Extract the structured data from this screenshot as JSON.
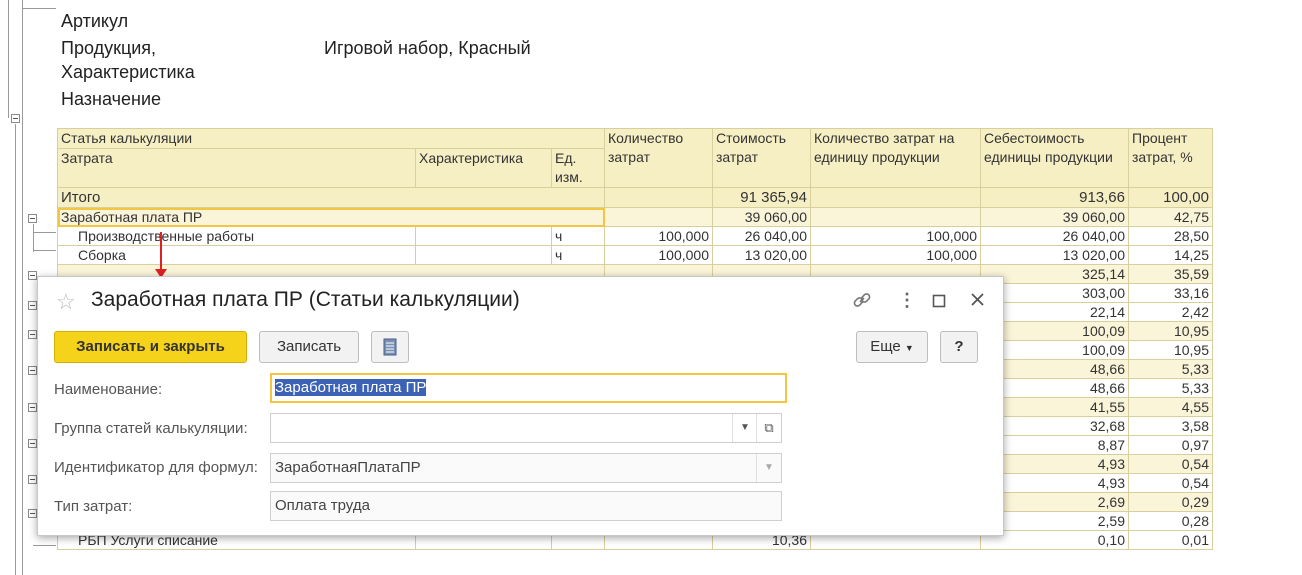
{
  "header": {
    "article_label": "Артикул",
    "product_label_1": "Продукция,",
    "product_label_2": "Характеристика",
    "product_value": "Игровой набор, Красный",
    "purpose_label": "Назначение"
  },
  "report": {
    "columns": {
      "item": "Статья калькуляции",
      "cost_item": "Затрата",
      "characteristic": "Характеристика",
      "unit_1": "Ед.",
      "unit_2": "изм.",
      "qty_1": "Количество",
      "qty_2": "затрат",
      "cost_1": "Стоимость",
      "cost_2": "затрат",
      "per_unit_1": "Количество затрат на",
      "per_unit_2": "единицу продукции",
      "unit_cost_1": "Себестоимость",
      "unit_cost_2": "единицы продукции",
      "percent_1": "Процент",
      "percent_2": "затрат, %"
    },
    "total": {
      "label": "Итого",
      "cost": "91 365,94",
      "unit_cost": "913,66",
      "percent": "100,00"
    },
    "rows": [
      {
        "name": "Заработная плата ПР",
        "char": "",
        "unit": "",
        "qty": "",
        "cost": "39 060,00",
        "per_unit": "",
        "unit_cost": "39 060,00",
        "percent": "42,75"
      },
      {
        "name": "Производственные работы",
        "char": "",
        "unit": "ч",
        "qty": "100,000",
        "cost": "26 040,00",
        "per_unit": "100,000",
        "unit_cost": "26 040,00",
        "percent": "28,50"
      },
      {
        "name": "Сборка",
        "char": "",
        "unit": "ч",
        "qty": "100,000",
        "cost": "13 020,00",
        "per_unit": "100,000",
        "unit_cost": "13 020,00",
        "percent": "14,25"
      }
    ],
    "right_values": [
      {
        "unit_cost": "325,14",
        "percent": "35,59"
      },
      {
        "unit_cost": "303,00",
        "percent": "33,16"
      },
      {
        "unit_cost": "22,14",
        "percent": "2,42"
      },
      {
        "unit_cost": "100,09",
        "percent": "10,95"
      },
      {
        "unit_cost": "100,09",
        "percent": "10,95"
      },
      {
        "unit_cost": "48,66",
        "percent": "5,33"
      },
      {
        "unit_cost": "48,66",
        "percent": "5,33"
      },
      {
        "unit_cost": "41,55",
        "percent": "4,55"
      },
      {
        "unit_cost": "32,68",
        "percent": "3,58"
      },
      {
        "unit_cost": "8,87",
        "percent": "0,97"
      },
      {
        "unit_cost": "4,93",
        "percent": "0,54"
      },
      {
        "unit_cost": "4,93",
        "percent": "0,54"
      },
      {
        "unit_cost": "2,69",
        "percent": "0,29"
      },
      {
        "unit_cost": "2,59",
        "percent": "0,28"
      }
    ],
    "last_row": {
      "name": "РБП Услуги списание",
      "cost": "10,36",
      "unit_cost": "0,10",
      "percent": "0,01"
    }
  },
  "dialog": {
    "title": "Заработная плата ПР (Статьи калькуляции)",
    "toolbar": {
      "save_close": "Записать и закрыть",
      "save": "Записать",
      "more": "Еще",
      "help": "?"
    },
    "fields": {
      "name_label": "Наименование:",
      "name_value": "Заработная плата ПР",
      "group_label": "Группа статей калькуляции:",
      "group_value": "",
      "id_label": "Идентификатор для формул:",
      "id_value": "ЗаработнаяПлатаПР",
      "cost_type_label": "Тип затрат:",
      "cost_type_value": "Оплата труда"
    }
  }
}
